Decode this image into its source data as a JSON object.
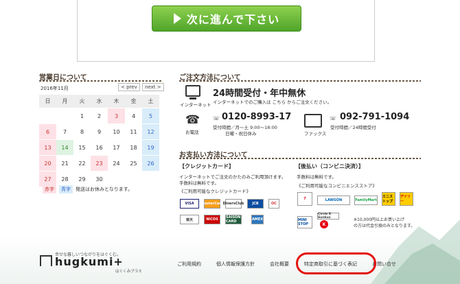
{
  "next_button": {
    "label": "次に進んで下さい"
  },
  "business_days": {
    "title": "営業日について",
    "month": "2016年11月",
    "prev": "< prev",
    "next": "next >",
    "weekdays": [
      "日",
      "月",
      "火",
      "水",
      "木",
      "金",
      "土"
    ],
    "rows": [
      [
        "",
        "",
        "1",
        "2",
        "3",
        "4",
        "5"
      ],
      [
        "6",
        "7",
        "8",
        "9",
        "10",
        "11",
        "12"
      ],
      [
        "13",
        "14",
        "15",
        "16",
        "17",
        "18",
        "19"
      ],
      [
        "20",
        "21",
        "22",
        "23",
        "24",
        "25",
        "26"
      ],
      [
        "27",
        "28",
        "29",
        "30",
        "",
        "",
        ""
      ]
    ],
    "legend_red": "赤字",
    "legend_blue": "青字",
    "legend_text": "発送はお休みとなります。"
  },
  "order": {
    "title": "ご注文方法について",
    "internet_label": "インターネット",
    "internet_head": "24時間受付・年中無休",
    "internet_sub": "インターネットでのご購入は こちら からご注文ください。",
    "internet_link": "こちら",
    "phone_label": "お電話",
    "phone_number": "0120-8993-17",
    "phone_hours": "受付時間／月～土 9:00～18:00",
    "phone_off": "日曜・祝日休み",
    "fax_label": "ファックス",
    "fax_number": "092-791-1094",
    "fax_hours": "受付時間／24時間受付"
  },
  "payment": {
    "title": "お支払い方法について",
    "credit_title": "【クレジットカード】",
    "credit_desc1": "インターネットでご注文のかたのみご利用頂けます。",
    "credit_desc2": "手数料は無料です。",
    "credit_cards_title": "《ご利用可能なクレジットカード》",
    "cards": [
      "VISA",
      "MasterCard",
      "DinersClub",
      "JCB",
      "OC",
      "楽天",
      "NICOS",
      "SAISON CARD",
      "AMEX"
    ],
    "conv_title": "【後払い（コンビニ決済）】",
    "conv_desc": "手数料は無料です。",
    "conv_stores_title": "《ご利用可能なコンビニエンスストア》",
    "stores": [
      "7",
      "LAWSON",
      "FamilyMart",
      "ミニストップ",
      "デイリー",
      "MINI STOP",
      "Circle K Sunkus",
      "K"
    ],
    "note1": "※10,000円以上お買い上げ",
    "note2": "の方は代金引換のみとなります。"
  },
  "footer": {
    "tagline": "幸せな暮しいつながりをはぐくむ。",
    "logo": "hugkumi+",
    "logo_sub": "はぐくみプラス",
    "links": [
      "ご利用規約",
      "個人情報保護方針",
      "会社概要",
      "特定商取引に基づく表記",
      "お問い合せ"
    ]
  }
}
